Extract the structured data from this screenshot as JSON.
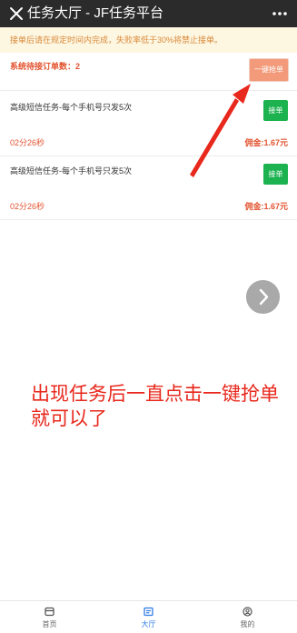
{
  "header": {
    "title": "任务大厅 - JF任务平台"
  },
  "notice": {
    "text": "接单后请在规定时间内完成，失败率低于30%将禁止接单。"
  },
  "pending": {
    "label": "系统待接订单数：2"
  },
  "grab_button": {
    "label": "一键抢单"
  },
  "tasks": [
    {
      "name": "高级短信任务-每个手机号只发5次",
      "time": "02分26秒",
      "commission": "佣金:1.67元",
      "accept_label": "接单"
    },
    {
      "name": "高级短信任务-每个手机号只发5次",
      "time": "02分26秒",
      "commission": "佣金:1.67元",
      "accept_label": "接单"
    }
  ],
  "annotation": {
    "text": "出现任务后一直点击一键抢单就可以了"
  },
  "tabbar": {
    "items": [
      {
        "label": "首页",
        "icon": "home-icon"
      },
      {
        "label": "大厅",
        "icon": "hall-icon"
      },
      {
        "label": "我的",
        "icon": "profile-icon"
      }
    ]
  },
  "colors": {
    "topbar": "#2b2b2b",
    "notice_bg": "#fdf6e1",
    "notice_text": "#d98a3a",
    "accent_red": "#e2532f",
    "grab_button": "#f29a7a",
    "accept_green": "#1bb24f",
    "annotation_red": "#e8281c",
    "tab_active": "#2e7ce5"
  }
}
